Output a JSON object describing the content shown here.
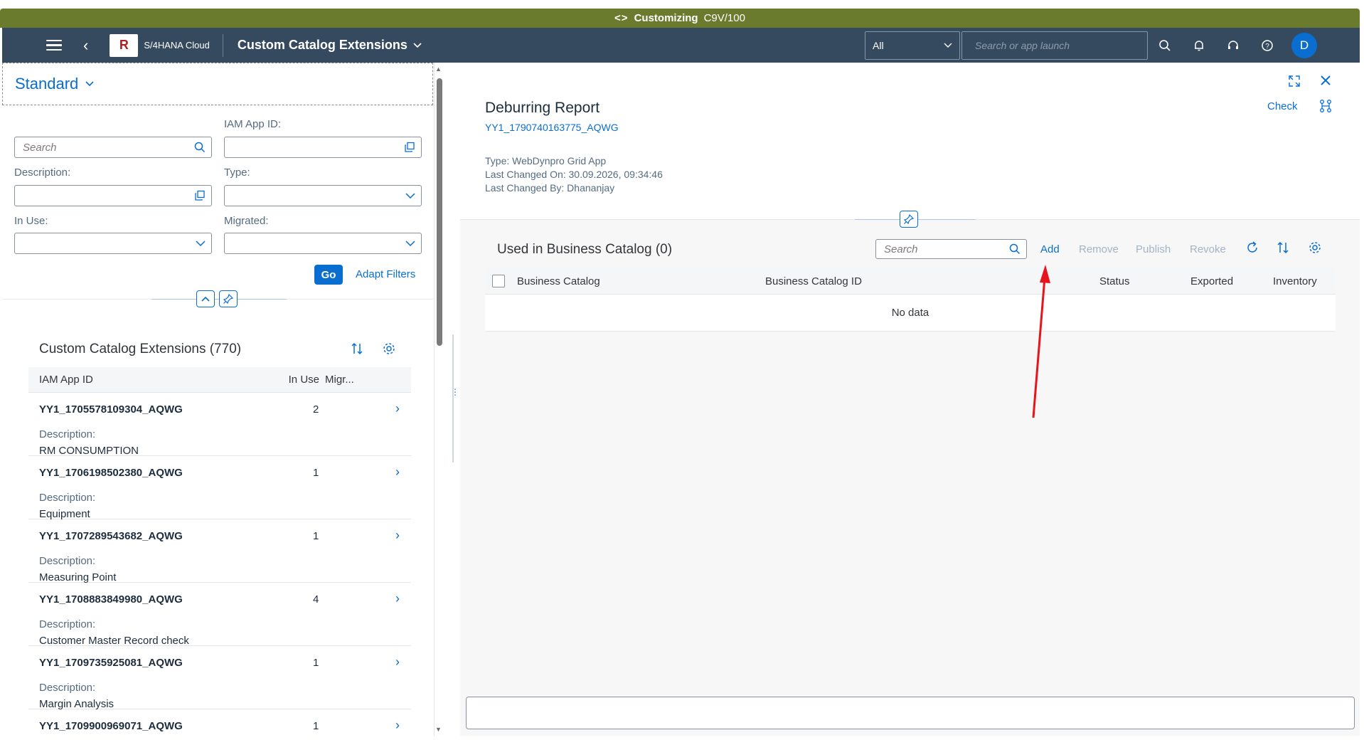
{
  "system_bar": {
    "icon": "code-icon",
    "title": "Customizing",
    "client": "C9V/100"
  },
  "shell": {
    "product": "S/4HANA Cloud",
    "app_title": "Custom Catalog Extensions",
    "logo_text": "R",
    "search_scope": "All",
    "search_placeholder": "Search or app launch",
    "user_initial": "D"
  },
  "filters": {
    "variant": "Standard",
    "search_placeholder": "Search",
    "iam_app_id_label": "IAM App ID:",
    "description_label": "Description:",
    "type_label": "Type:",
    "in_use_label": "In Use:",
    "migrated_label": "Migrated:",
    "go_label": "Go",
    "adapt_label": "Adapt Filters"
  },
  "list": {
    "title": "Custom Catalog Extensions (770)",
    "columns": {
      "id": "IAM App ID",
      "in_use": "In Use",
      "migrated": "Migr..."
    },
    "description_label": "Description:",
    "items": [
      {
        "id": "YY1_1705578109304_AQWG",
        "in_use": "2",
        "description": "RM CONSUMPTION"
      },
      {
        "id": "YY1_1706198502380_AQWG",
        "in_use": "1",
        "description": "Equipment"
      },
      {
        "id": "YY1_1707289543682_AQWG",
        "in_use": "1",
        "description": "Measuring Point"
      },
      {
        "id": "YY1_1708883849980_AQWG",
        "in_use": "4",
        "description": "Customer Master Record check"
      },
      {
        "id": "YY1_1709735925081_AQWG",
        "in_use": "1",
        "description": "Margin Analysis"
      },
      {
        "id": "YY1_1709900969071_AQWG",
        "in_use": "1",
        "description": ""
      }
    ]
  },
  "detail": {
    "title": "Deburring Report",
    "subtitle": "YY1_1790740163775_AQWG",
    "type": "Type: WebDynpro Grid App",
    "changed_on": "Last Changed On: 30.09.2026, 09:34:46",
    "changed_by": "Last Changed By: Dhananjay",
    "check_label": "Check",
    "section_title": "Used in Business Catalog (0)",
    "search_placeholder": "Search",
    "actions": {
      "add": "Add",
      "remove": "Remove",
      "publish": "Publish",
      "revoke": "Revoke"
    },
    "columns": {
      "catalog": "Business Catalog",
      "catalog_id": "Business Catalog ID",
      "status": "Status",
      "exported": "Exported",
      "inventory": "Inventory"
    },
    "no_data": "No data"
  },
  "colors": {
    "accent": "#0a6ed1",
    "shell": "#354a5f",
    "system_bar": "#6a7b2e",
    "annotation": "#e8141b"
  }
}
